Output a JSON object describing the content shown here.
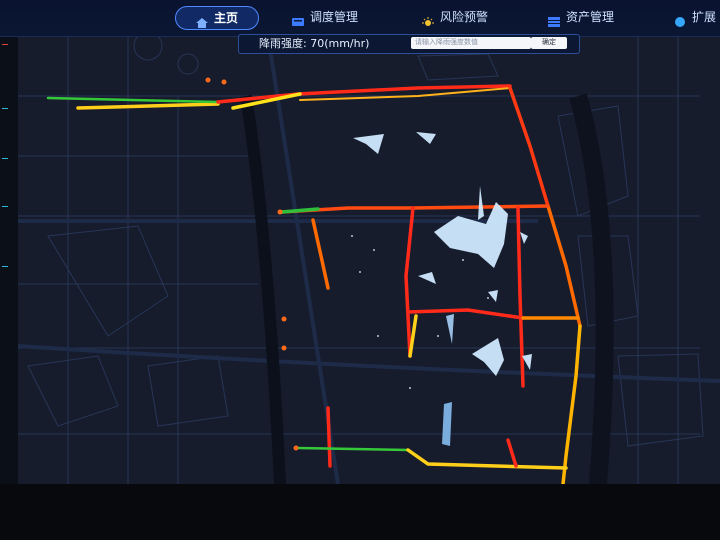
{
  "nav": {
    "items": [
      {
        "label": "主页",
        "icon": "home-icon",
        "active": true
      },
      {
        "label": "调度管理",
        "icon": "dispatch-icon",
        "active": false
      },
      {
        "label": "风险预警",
        "icon": "warning-sun-icon",
        "active": false
      },
      {
        "label": "资产管理",
        "icon": "asset-icon",
        "active": false
      },
      {
        "label": "扩展",
        "icon": "extend-icon",
        "active": false
      }
    ]
  },
  "rain_panel": {
    "label": "降雨强度: 70(mm/hr)",
    "input_placeholder": "请输入降雨强度数值",
    "confirm_label": "确定"
  },
  "colors": {
    "road_severe": "#ff2a1a",
    "road_high": "#ff6a00",
    "road_medium": "#ffd21a",
    "road_normal": "#35c93a",
    "flood_pool": "#cfe9ff",
    "accent": "#4f88ff"
  }
}
